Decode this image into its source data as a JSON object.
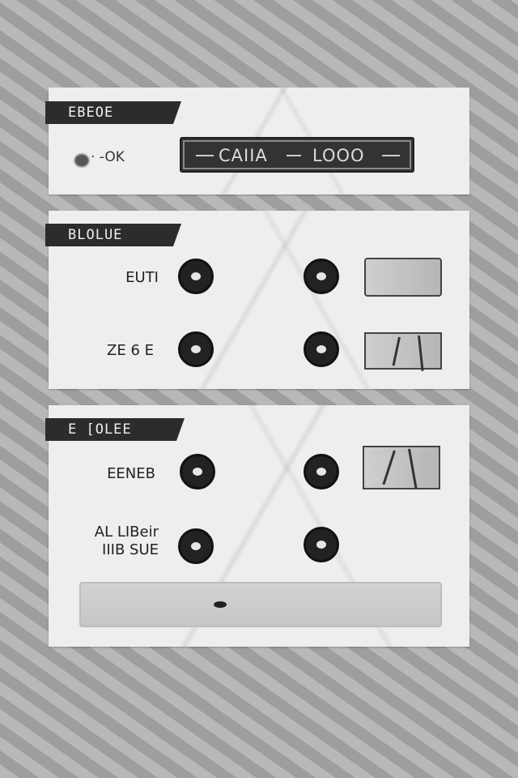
{
  "panels": {
    "top": {
      "ribbon_label": "EBEOE",
      "ok_label": "· -OK",
      "title_box": {
        "left_text": "CAIIA",
        "right_text": "LOOO"
      }
    },
    "middle": {
      "ribbon_label": "BLOLUE",
      "rows": [
        {
          "label": "EUTI"
        },
        {
          "label": "ZE 6 E"
        }
      ]
    },
    "bottom": {
      "ribbon_label": "E [OLEE",
      "rows": [
        {
          "label": "EENEB"
        },
        {
          "label": "AL LIBeir",
          "label2": "IIIB SUE"
        }
      ],
      "slider": {
        "value": 0.35
      }
    }
  }
}
